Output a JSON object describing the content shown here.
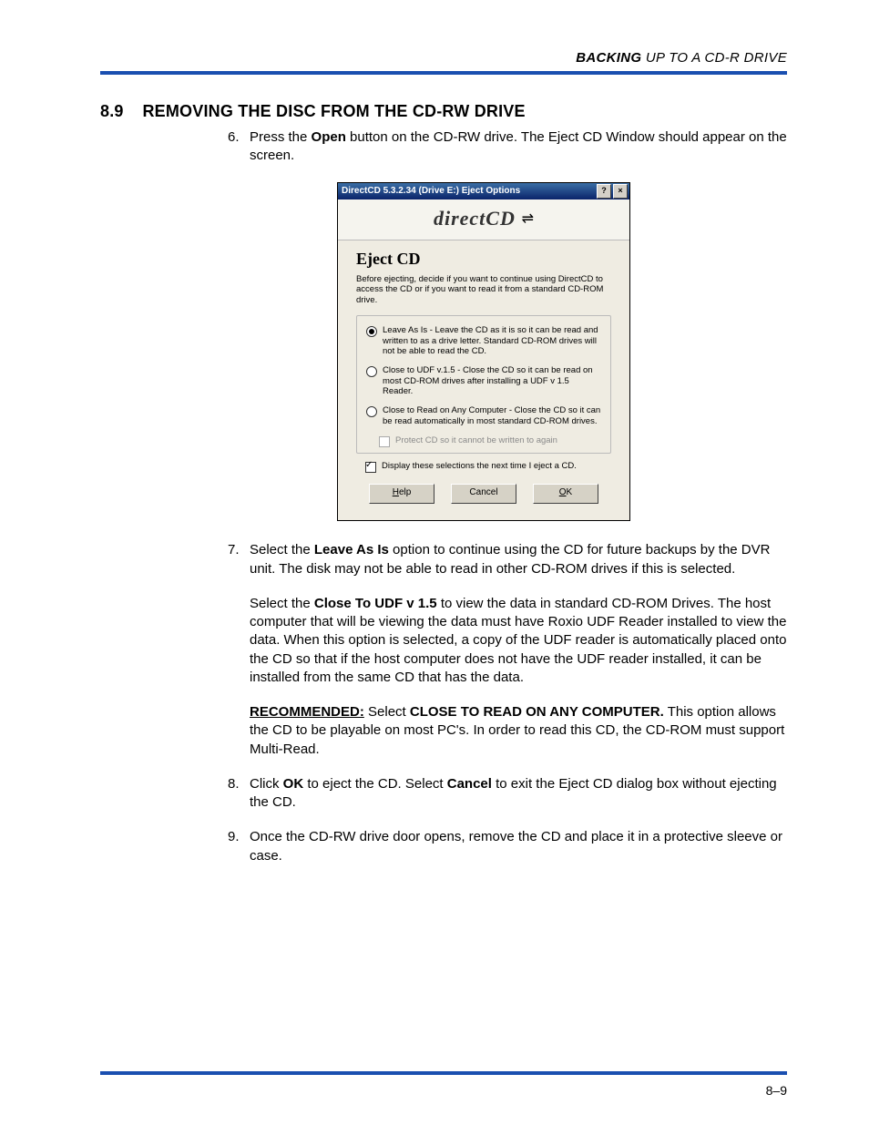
{
  "running_head_bold": "BACKING",
  "running_head_rest": " UP TO A CD-R DRIVE",
  "section_number": "8.9",
  "section_title": "REMOVING THE DISC FROM THE CD-RW DRIVE",
  "page_number": "8–9",
  "steps": {
    "s6_n": "6.",
    "s6_a": "Press the ",
    "s6_b": "Open",
    "s6_c": " button on the CD-RW drive. The Eject CD Window should appear on the screen.",
    "s7_n": "7.",
    "s7_a": "Select the ",
    "s7_b": "Leave As Is",
    "s7_c": " option to continue using the CD for future backups by the DVR unit. The disk may not be able to read in other CD-ROM drives if this is selected.",
    "s7_p2_a": "Select the ",
    "s7_p2_b": "Close To UDF v 1.5",
    "s7_p2_c": " to view the data in standard CD-ROM Drives. The host computer that will be viewing the data must have Roxio UDF Reader installed to view the data. When this option is selected, a copy of the UDF reader is automatically placed onto the CD so that if the host computer does not have the UDF reader installed, it can be installed from the same CD that has the data.",
    "s7_p3_a": "RECOMMENDED:",
    "s7_p3_b": " Select ",
    "s7_p3_c": "CLOSE TO READ ON ANY COMPUTER.",
    "s7_p3_d": " This option allows the CD to be playable on most PC's. In order to read this CD, the CD-ROM must support Multi-Read.",
    "s8_n": "8.",
    "s8_a": "Click ",
    "s8_b": "OK",
    "s8_c": " to eject the CD. Select ",
    "s8_d": "Cancel",
    "s8_e": " to exit the Eject CD dialog box without ejecting the CD.",
    "s9_n": "9.",
    "s9_a": "Once the CD-RW drive door opens, remove the CD and place it in a protective sleeve or case."
  },
  "dialog": {
    "title": "DirectCD 5.3.2.34 (Drive E:) Eject Options",
    "help_glyph": "?",
    "close_glyph": "×",
    "brand": "directCD",
    "brand_icon": "⇌",
    "heading": "Eject CD",
    "desc": "Before ejecting, decide if you want to continue using DirectCD to access the CD or if you want to read it from a standard CD-ROM drive.",
    "opt1": "Leave As Is - Leave the CD as it is so it can be read and written to as a drive letter. Standard CD-ROM drives will not be able to read the CD.",
    "opt2": "Close to UDF v.1.5 - Close the CD so it can be read on most CD-ROM drives after installing a UDF v 1.5 Reader.",
    "opt3": "Close to Read on Any Computer - Close the CD so it can be read automatically in most standard CD-ROM drives.",
    "protect": "Protect CD so it cannot be written to again",
    "display_again": "Display these selections the next time I eject a CD.",
    "btn_help": "Help",
    "btn_help_mn": "H",
    "btn_cancel": "Cancel",
    "btn_ok": "OK",
    "btn_ok_mn": "O"
  }
}
